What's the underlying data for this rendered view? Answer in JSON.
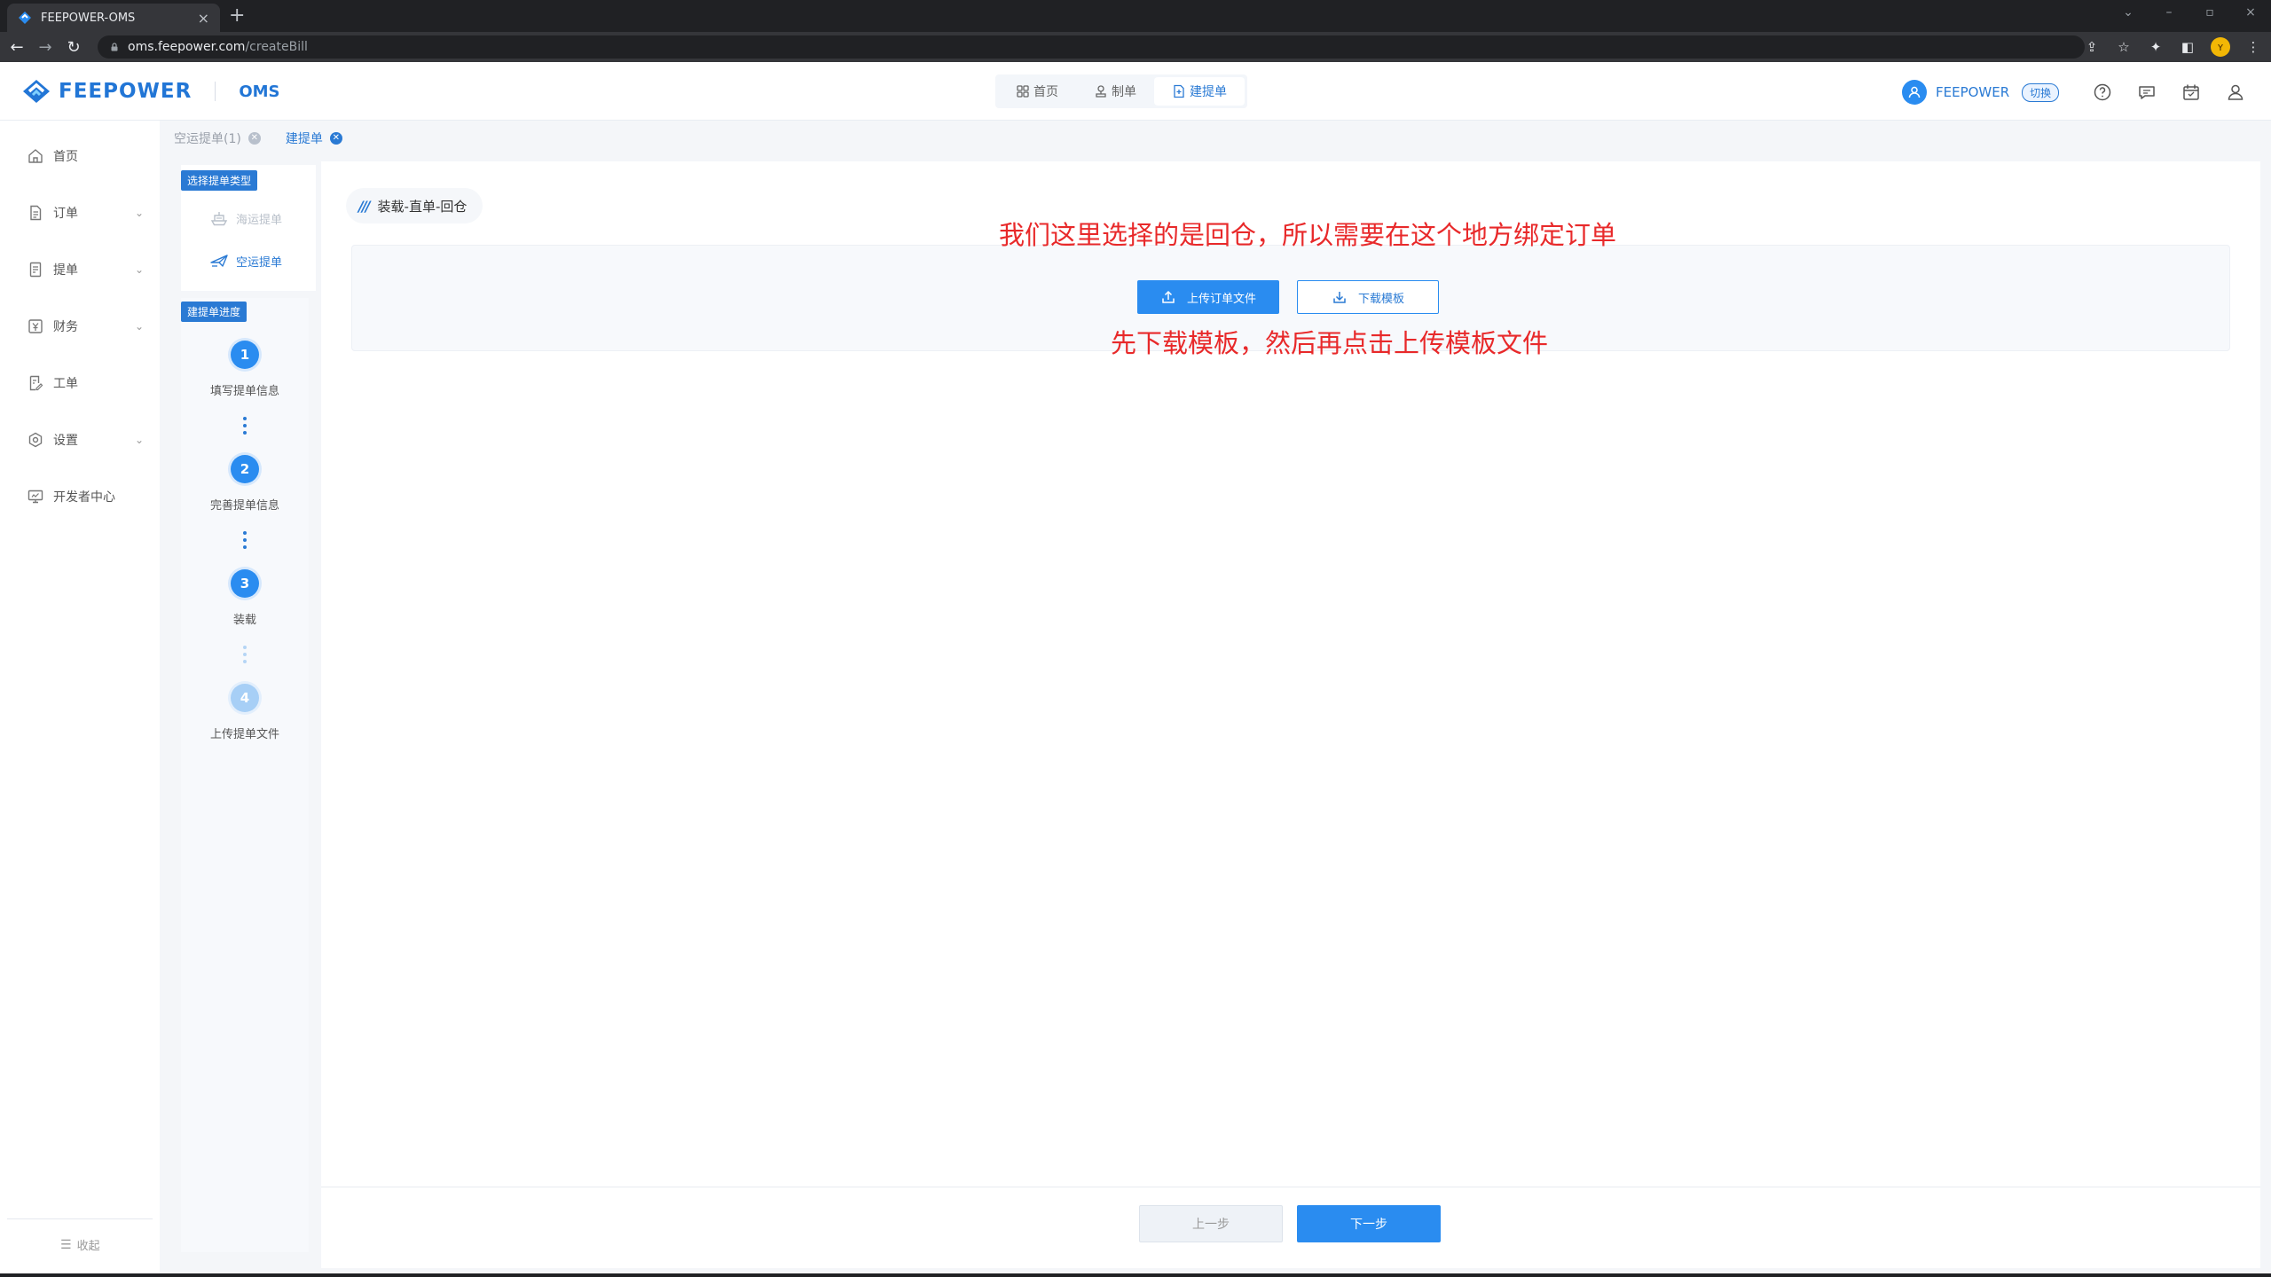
{
  "browser": {
    "tab_title": "FEEPOWER-OMS",
    "url_host": "oms.feepower.com",
    "url_path": "/createBill"
  },
  "header": {
    "brand": "FEEPOWER",
    "system": "OMS",
    "nav": [
      {
        "label": "首页",
        "icon": "grid-icon"
      },
      {
        "label": "制单",
        "icon": "stamp-icon"
      },
      {
        "label": "建提单",
        "icon": "doc-add-icon"
      }
    ],
    "user_name": "FEEPOWER",
    "switch_label": "切换",
    "accent": "#2a7ad4"
  },
  "sidebar": {
    "items": [
      {
        "label": "首页",
        "icon": "home-icon"
      },
      {
        "label": "订单",
        "icon": "order-icon"
      },
      {
        "label": "提单",
        "icon": "bill-icon"
      },
      {
        "label": "财务",
        "icon": "finance-icon"
      },
      {
        "label": "工单",
        "icon": "ticket-icon"
      },
      {
        "label": "设置",
        "icon": "settings-icon"
      },
      {
        "label": "开发者中心",
        "icon": "developer-icon"
      }
    ],
    "collapse_label": "收起"
  },
  "page_tabs": [
    {
      "label": "空运提单(1)"
    },
    {
      "label": "建提单"
    }
  ],
  "type_panel": {
    "title": "选择提单类型",
    "options": [
      {
        "label": "海运提单",
        "icon": "ship-icon"
      },
      {
        "label": "空运提单",
        "icon": "plane-icon"
      }
    ]
  },
  "progress": {
    "title": "建提单进度",
    "steps": [
      {
        "num": "1",
        "label": "填写提单信息"
      },
      {
        "num": "2",
        "label": "完善提单信息"
      },
      {
        "num": "3",
        "label": "装载"
      },
      {
        "num": "4",
        "label": "上传提单文件"
      }
    ]
  },
  "main": {
    "section_title": "装载-直单-回仓",
    "upload_label": "上传订单文件",
    "download_label": "下载模板",
    "note_top": "我们这里选择的是回仓，所以需要在这个地方绑定订单",
    "note_bottom": "先下载模板，然后再点击上传模板文件",
    "note_color": "#e8292a"
  },
  "footer": {
    "prev_label": "上一步",
    "next_label": "下一步"
  }
}
